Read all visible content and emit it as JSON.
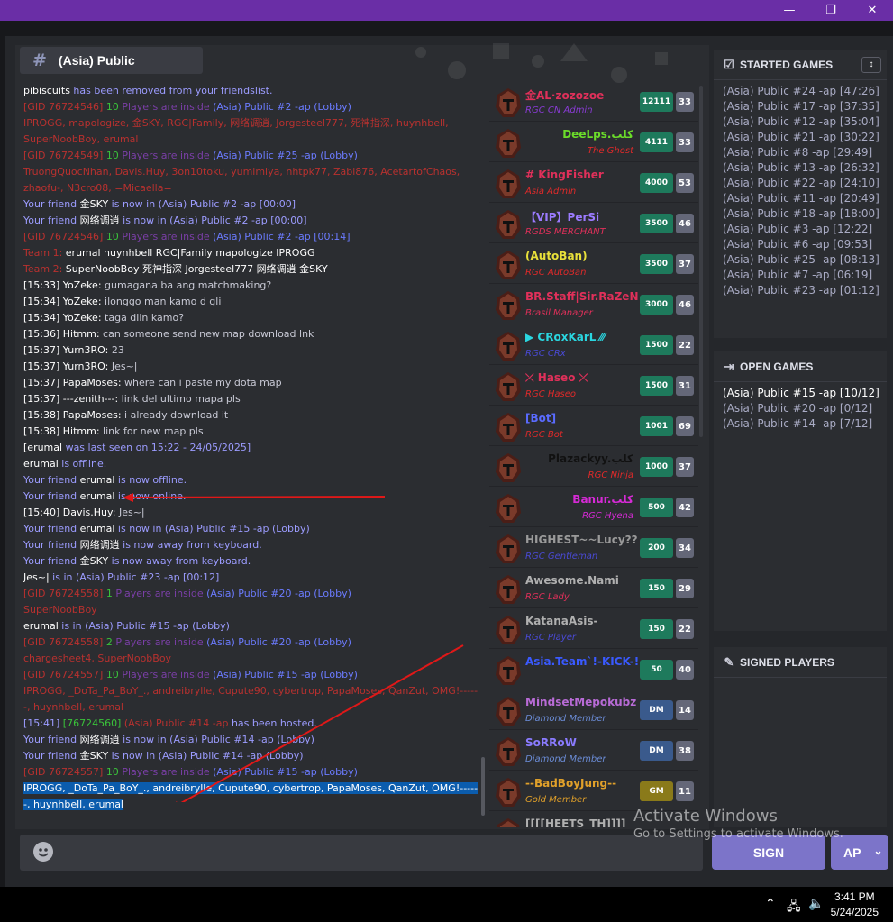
{
  "window": {
    "minimize": "—",
    "restore": "❐",
    "close": "✕"
  },
  "channel": {
    "hash": "#",
    "title": "(Asia) Public"
  },
  "chat": [
    [
      {
        "t": "pibiscuits",
        "c": "c-white"
      },
      {
        "t": " has been removed from your friendslist.",
        "c": "c-lav"
      }
    ],
    [
      {
        "t": "[GID 76724546] ",
        "c": "c-red"
      },
      {
        "t": "10 ",
        "c": "c-green"
      },
      {
        "t": "Players are inside ",
        "c": "c-purp"
      },
      {
        "t": "(Asia) Public #2 -ap (Lobby)",
        "c": "c-blue"
      }
    ],
    [
      {
        "t": "IPROGG, mapologize, 金SKY, RGC|Family, 网络调逍, Jorgesteel777, 死神指深, huynhbell, SuperNoobBoy, erumal",
        "c": "c-red"
      }
    ],
    [
      {
        "t": "[GID 76724549] ",
        "c": "c-red"
      },
      {
        "t": "10 ",
        "c": "c-green"
      },
      {
        "t": "Players are inside ",
        "c": "c-purp"
      },
      {
        "t": "(Asia) Public #25 -ap (Lobby)",
        "c": "c-blue"
      }
    ],
    [
      {
        "t": "TruongQuocNhan, Davis.Huy, 3on10toku, yumimiya, nhtpk77, Zabi876, AcetartofChaos, zhaofu-, N3cro08, =Micaella=",
        "c": "c-red"
      }
    ],
    [
      {
        "t": "Your friend ",
        "c": "c-lav"
      },
      {
        "t": "金SKY",
        "c": "c-white"
      },
      {
        "t": " is now in (Asia) Public #2 -ap [00:00]",
        "c": "c-lav"
      }
    ],
    [
      {
        "t": "Your friend ",
        "c": "c-lav"
      },
      {
        "t": "网络调逍",
        "c": "c-white"
      },
      {
        "t": " is now in (Asia) Public #2 -ap [00:00]",
        "c": "c-lav"
      }
    ],
    [
      {
        "t": "[GID 76724546] ",
        "c": "c-red"
      },
      {
        "t": "10 ",
        "c": "c-green"
      },
      {
        "t": "Players are inside ",
        "c": "c-purp"
      },
      {
        "t": "(Asia) Public #2 -ap [00:14]",
        "c": "c-blue"
      }
    ],
    [
      {
        "t": "Team 1:   ",
        "c": "c-red"
      },
      {
        "t": "erumal    huynhbell    RGC|Family    mapologize    IPROGG",
        "c": "c-white"
      }
    ],
    [
      {
        "t": "Team 2:   ",
        "c": "c-red"
      },
      {
        "t": "SuperNoobBoy    死神指深    Jorgesteel777    网络调逍    金SKY",
        "c": "c-white"
      }
    ],
    [
      {
        "t": "[15:33] YoZeke:",
        "c": "c-white"
      },
      {
        "t": " gumagana ba ang matchmaking?",
        "c": "c-dim"
      }
    ],
    [
      {
        "t": "[15:34] YoZeke:",
        "c": "c-white"
      },
      {
        "t": " ilonggo man kamo d gli",
        "c": "c-dim"
      }
    ],
    [
      {
        "t": "[15:34] YoZeke:",
        "c": "c-white"
      },
      {
        "t": " taga diin kamo?",
        "c": "c-dim"
      }
    ],
    [
      {
        "t": "[15:36] Hitmm:",
        "c": "c-white"
      },
      {
        "t": " can someone send new map download lnk",
        "c": "c-dim"
      }
    ],
    [
      {
        "t": "[15:37] Yurn3RO:",
        "c": "c-white"
      },
      {
        "t": " 23",
        "c": "c-dim"
      }
    ],
    [
      {
        "t": "[15:37] Yurn3RO:",
        "c": "c-white"
      },
      {
        "t": " Jes~|",
        "c": "c-dim"
      }
    ],
    [
      {
        "t": "[15:37] PapaMoses:",
        "c": "c-white"
      },
      {
        "t": " where can i paste my dota map",
        "c": "c-dim"
      }
    ],
    [
      {
        "t": "[15:37] ---zenith---:",
        "c": "c-white"
      },
      {
        "t": " link del ultimo mapa pls",
        "c": "c-dim"
      }
    ],
    [
      {
        "t": "[15:38] PapaMoses:",
        "c": "c-white"
      },
      {
        "t": " i already download it",
        "c": "c-dim"
      }
    ],
    [
      {
        "t": "[15:38] Hitmm:",
        "c": "c-white"
      },
      {
        "t": " link for new map pls",
        "c": "c-dim"
      }
    ],
    [
      {
        "t": "[",
        "c": "c-white"
      },
      {
        "t": "erumal",
        "c": "c-white"
      },
      {
        "t": " was last seen on 15:22 - 24/05/2025]",
        "c": "c-lav"
      }
    ],
    [
      {
        "t": "erumal",
        "c": "c-white"
      },
      {
        "t": " is offline.",
        "c": "c-lav"
      }
    ],
    [
      {
        "t": "Your friend ",
        "c": "c-lav"
      },
      {
        "t": "erumal",
        "c": "c-white"
      },
      {
        "t": " is now offline.",
        "c": "c-lav"
      }
    ],
    [
      {
        "t": "Your friend ",
        "c": "c-lav"
      },
      {
        "t": "erumal",
        "c": "c-white"
      },
      {
        "t": " is now online.",
        "c": "c-lav"
      }
    ],
    [
      {
        "t": "[15:40] Davis.Huy:",
        "c": "c-white"
      },
      {
        "t": " Jes~|",
        "c": "c-dim"
      }
    ],
    [
      {
        "t": "Your friend ",
        "c": "c-lav"
      },
      {
        "t": "erumal",
        "c": "c-white"
      },
      {
        "t": " is now in (Asia) Public #15 -ap (Lobby)",
        "c": "c-lav"
      }
    ],
    [
      {
        "t": "Your friend ",
        "c": "c-lav"
      },
      {
        "t": "网络调逍",
        "c": "c-white"
      },
      {
        "t": " is now away from keyboard.",
        "c": "c-lav"
      }
    ],
    [
      {
        "t": "Your friend ",
        "c": "c-lav"
      },
      {
        "t": "金SKY",
        "c": "c-white"
      },
      {
        "t": " is now away from keyboard.",
        "c": "c-lav"
      }
    ],
    [
      {
        "t": "Jes~|",
        "c": "c-white"
      },
      {
        "t": " is in (Asia) Public #23 -ap [00:12]",
        "c": "c-lav"
      }
    ],
    [
      {
        "t": "[GID 76724558] ",
        "c": "c-red"
      },
      {
        "t": "1 ",
        "c": "c-green"
      },
      {
        "t": "Players are inside ",
        "c": "c-purp"
      },
      {
        "t": "(Asia) Public #20 -ap (Lobby)",
        "c": "c-blue"
      }
    ],
    [
      {
        "t": "SuperNoobBoy",
        "c": "c-red"
      }
    ],
    [
      {
        "t": "erumal",
        "c": "c-white"
      },
      {
        "t": " is in (Asia) Public #15 -ap (Lobby)",
        "c": "c-lav"
      }
    ],
    [
      {
        "t": "[GID 76724558] ",
        "c": "c-red"
      },
      {
        "t": "2 ",
        "c": "c-green"
      },
      {
        "t": "Players are inside ",
        "c": "c-purp"
      },
      {
        "t": "(Asia) Public #20 -ap (Lobby)",
        "c": "c-blue"
      }
    ],
    [
      {
        "t": "chargesheet4, SuperNoobBoy",
        "c": "c-red"
      }
    ],
    [
      {
        "t": "[GID 76724557] ",
        "c": "c-red"
      },
      {
        "t": "10 ",
        "c": "c-green"
      },
      {
        "t": "Players are inside ",
        "c": "c-purp"
      },
      {
        "t": "(Asia) Public #15 -ap (Lobby)",
        "c": "c-blue"
      }
    ],
    [
      {
        "t": "IPROGG, _DoTa_Pa_BoY_., andreibrylle, Cupute90, cybertrop, PapaMoses, QanZut, OMG!------, huynhbell, erumal",
        "c": "c-red"
      }
    ],
    [
      {
        "t": "[15:41] ",
        "c": "c-lav"
      },
      {
        "t": "[76724560] ",
        "c": "c-green"
      },
      {
        "t": "(Asia) Public #14 -ap",
        "c": "c-red"
      },
      {
        "t": " has been hosted.",
        "c": "c-lav"
      }
    ],
    [
      {
        "t": "Your friend ",
        "c": "c-lav"
      },
      {
        "t": "网络调逍",
        "c": "c-white"
      },
      {
        "t": " is now in (Asia) Public #14 -ap (Lobby)",
        "c": "c-lav"
      }
    ],
    [
      {
        "t": "Your friend ",
        "c": "c-lav"
      },
      {
        "t": "金SKY",
        "c": "c-white"
      },
      {
        "t": " is now in (Asia) Public #14 -ap (Lobby)",
        "c": "c-lav"
      }
    ],
    [
      {
        "t": "[GID 76724557] ",
        "c": "c-red"
      },
      {
        "t": "10 ",
        "c": "c-green"
      },
      {
        "t": "Players are inside ",
        "c": "c-purp"
      },
      {
        "t": "(Asia) Public #15 -ap (Lobby)",
        "c": "c-blue"
      }
    ],
    [
      {
        "t": "IPROGG, _DoTa_Pa_BoY_., andreibrylle, Cupute90, cybertrop, PapaMoses, QanZut, OMG!------, huynhbell, erumal",
        "c": "sel"
      }
    ]
  ],
  "players": [
    {
      "name": "金AL·zozozoe",
      "nc": "#e0305a",
      "role": "RGC CN Admin",
      "rc": "#8a3bd6",
      "score": "12111",
      "lvl": "33",
      "sc": "#1e7a5c",
      "align": "left"
    },
    {
      "name": "DeeLps.كلب",
      "nc": "#6bdc2a",
      "role": "The Ghost",
      "rc": "#e02a2a",
      "score": "4111",
      "lvl": "33",
      "sc": "#1e7a5c",
      "align": "right"
    },
    {
      "name": "# KingFisher",
      "nc": "#e0305a",
      "role": "Asia Admin",
      "rc": "#e02a2a",
      "score": "4000",
      "lvl": "53",
      "sc": "#1e7a5c",
      "align": "left"
    },
    {
      "name": "【VIP】PerSi",
      "nc": "#9b7bff",
      "role": "RGDS MERCHANT",
      "rc": "#e0305a",
      "score": "3500",
      "lvl": "46",
      "sc": "#1e7a5c",
      "align": "left"
    },
    {
      "name": "(AutoBan)",
      "nc": "#e8e03a",
      "role": "RGC AutoBan",
      "rc": "#e02a2a",
      "score": "3500",
      "lvl": "37",
      "sc": "#1e7a5c",
      "align": "left"
    },
    {
      "name": "BR.Staff|Sir.RaZeN",
      "nc": "#e0305a",
      "role": "Brasil Manager",
      "rc": "#e0305a",
      "score": "3000",
      "lvl": "46",
      "sc": "#1e7a5c",
      "align": "left"
    },
    {
      "name": "▶ CRoxKarL ⁄⁄⁄",
      "nc": "#2ad6e0",
      "role": "RGC CRx",
      "rc": "#4a4ad6",
      "score": "1500",
      "lvl": "22",
      "sc": "#1e7a5c",
      "align": "left"
    },
    {
      "name": "⤫ Haseo ⤫",
      "nc": "#e0305a",
      "role": "RGC Haseo",
      "rc": "#e02a2a",
      "score": "1500",
      "lvl": "31",
      "sc": "#1e7a5c",
      "align": "left"
    },
    {
      "name": "[Bot]",
      "nc": "#5a6bff",
      "role": "RGC Bot",
      "rc": "#e02a2a",
      "score": "1001",
      "lvl": "69",
      "sc": "#1e7a5c",
      "align": "left"
    },
    {
      "name": "Plazackyy.كلب",
      "nc": "#111111",
      "role": "RGC Ninja",
      "rc": "#e02a2a",
      "score": "1000",
      "lvl": "37",
      "sc": "#1e7a5c",
      "align": "right"
    },
    {
      "name": "Banur.كلب",
      "nc": "#d62ad6",
      "role": "RGC Hyena",
      "rc": "#d62ad6",
      "score": "500",
      "lvl": "42",
      "sc": "#1e7a5c",
      "align": "right"
    },
    {
      "name": "HIGHEST~~Lucy??",
      "nc": "#9a9a9a",
      "role": "RGC Gentleman",
      "rc": "#4a4ad6",
      "score": "200",
      "lvl": "34",
      "sc": "#1e7a5c",
      "align": "left"
    },
    {
      "name": "Awesome.Nami",
      "nc": "#b0b0b0",
      "role": "RGC Lady",
      "rc": "#e0305a",
      "score": "150",
      "lvl": "29",
      "sc": "#1e7a5c",
      "align": "left"
    },
    {
      "name": "KatanaAsis-",
      "nc": "#b0b0b0",
      "role": "RGC Player",
      "rc": "#4a4ad6",
      "score": "150",
      "lvl": "22",
      "sc": "#1e7a5c",
      "align": "left"
    },
    {
      "name": "Asia.Team`!-KICK-!",
      "nc": "#3a5aff",
      "role": "",
      "rc": "#4a4ad6",
      "score": "50",
      "lvl": "40",
      "sc": "#1e7a5c",
      "align": "left"
    },
    {
      "name": "MindsetMepokubz",
      "nc": "#b86bd6",
      "role": "Diamond Member",
      "rc": "#6b8cd6",
      "score": "DM",
      "lvl": "14",
      "sc": "#3a5a8c",
      "align": "left"
    },
    {
      "name": "SoRRoW",
      "nc": "#8a7bff",
      "role": "Diamond Member",
      "rc": "#6b8cd6",
      "score": "DM",
      "lvl": "38",
      "sc": "#3a5a8c",
      "align": "left"
    },
    {
      "name": "--BadBoyJung--",
      "nc": "#e0a02a",
      "role": "Gold Member",
      "rc": "#e0a02a",
      "score": "GM",
      "lvl": "11",
      "sc": "#8a7a1a",
      "align": "left"
    },
    {
      "name": "[[[[HEETS_TH]]]]",
      "nc": "#b0b0b0",
      "role": "",
      "rc": "#b0b0b0",
      "score": "",
      "lvl": "",
      "sc": "#2b2d31",
      "align": "left"
    }
  ],
  "started": {
    "title": "STARTED GAMES",
    "items": [
      "(Asia) Public #24 -ap [47:26]",
      "(Asia) Public #17 -ap [37:35]",
      "(Asia) Public #12 -ap [35:04]",
      "(Asia) Public #21 -ap [30:22]",
      "(Asia) Public #8 -ap [29:49]",
      "(Asia) Public #13 -ap [26:32]",
      "(Asia) Public #22 -ap [24:10]",
      "(Asia) Public #11 -ap [20:49]",
      "(Asia) Public #18 -ap [18:00]",
      "(Asia) Public #3 -ap [12:22]",
      "(Asia) Public #6 -ap [09:53]",
      "(Asia) Public #25 -ap [08:13]",
      "(Asia) Public #7 -ap [06:19]",
      "(Asia) Public #23 -ap [01:12]"
    ]
  },
  "open": {
    "title": "OPEN GAMES",
    "items": [
      "(Asia) Public #15 -ap [10/12]",
      "(Asia) Public #20 -ap [0/12]",
      "(Asia) Public #14 -ap [7/12]"
    ]
  },
  "signed": {
    "title": "SIGNED PLAYERS"
  },
  "input": {
    "sign": "SIGN",
    "ap": "AP",
    "ap_caret": "⌄"
  },
  "watermark": {
    "line1": "Activate Windows",
    "line2": "Go to Settings to activate Windows."
  },
  "taskbar": {
    "time": "3:41 PM",
    "date": "5/24/2025"
  }
}
